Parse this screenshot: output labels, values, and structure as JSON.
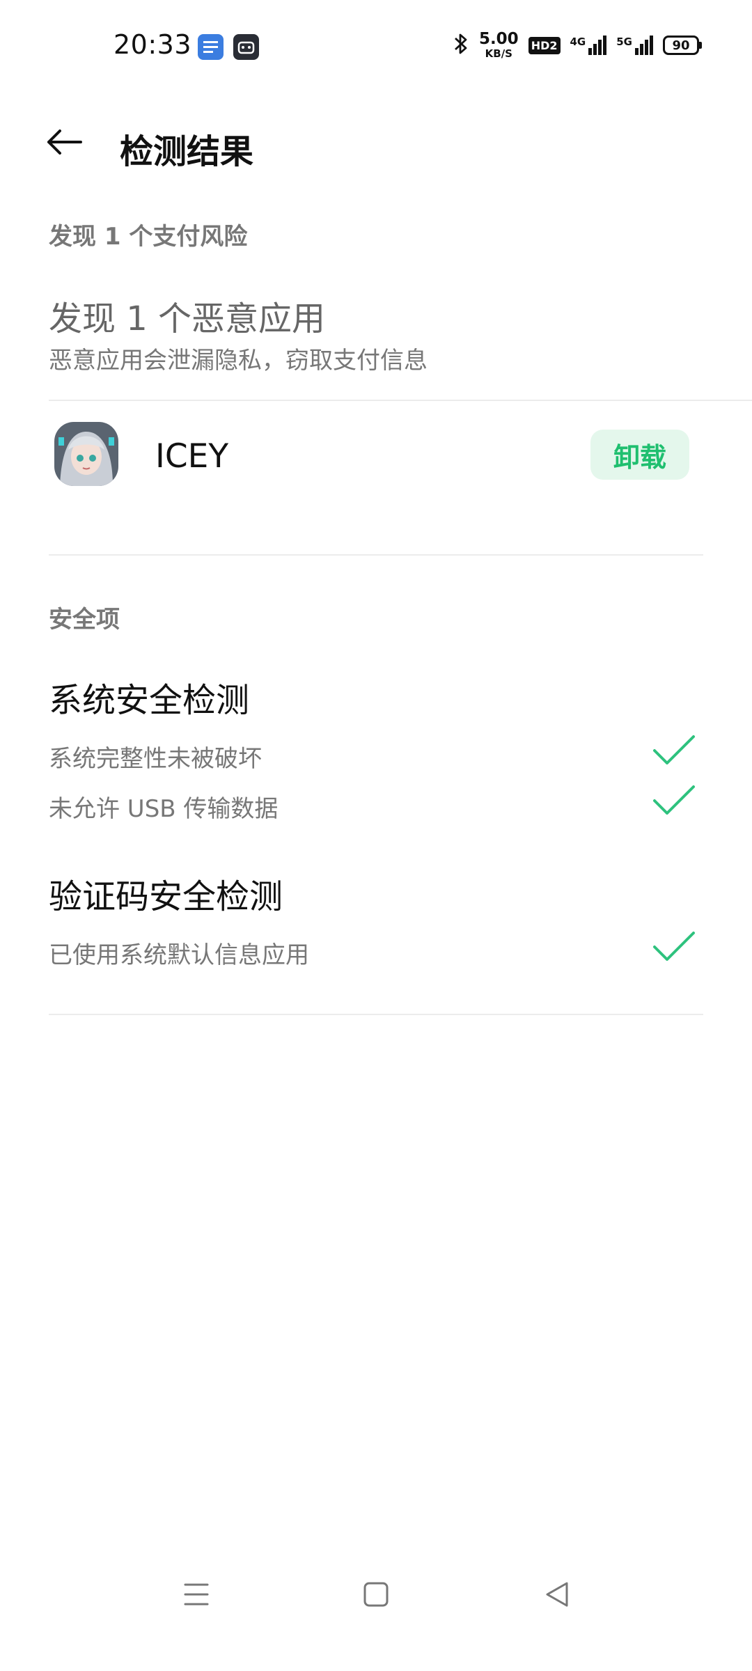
{
  "status_bar": {
    "time": "20:33",
    "notification_icons": [
      "app-notification-icon",
      "game-notification-icon"
    ],
    "network_speed_value": "5.00",
    "network_speed_unit": "KB/S",
    "hd_badge": "HD2",
    "signal_1_label": "4G",
    "signal_2_label": "5G",
    "battery_level": "90"
  },
  "header": {
    "title": "检测结果"
  },
  "payment_risk": {
    "section_label": "发现 1 个支付风险",
    "title": "发现 1 个恶意应用",
    "description": "恶意应用会泄漏隐私，窃取支付信息",
    "app": {
      "name": "ICEY",
      "action_label": "卸载"
    }
  },
  "security": {
    "section_label": "安全项",
    "groups": [
      {
        "title": "系统安全检测",
        "items": [
          {
            "label": "系统完整性未被破坏"
          },
          {
            "label": "未允许 USB 传输数据"
          }
        ]
      },
      {
        "title": "验证码安全检测",
        "items": [
          {
            "label": "已使用系统默认信息应用"
          }
        ]
      }
    ]
  },
  "colors": {
    "accent_green": "#1fbf6f",
    "button_bg": "#e4f7ec",
    "check_green": "#2ec27e"
  },
  "nav_bar": {
    "icons": [
      "menu-icon",
      "home-icon",
      "back-triangle-icon"
    ]
  }
}
